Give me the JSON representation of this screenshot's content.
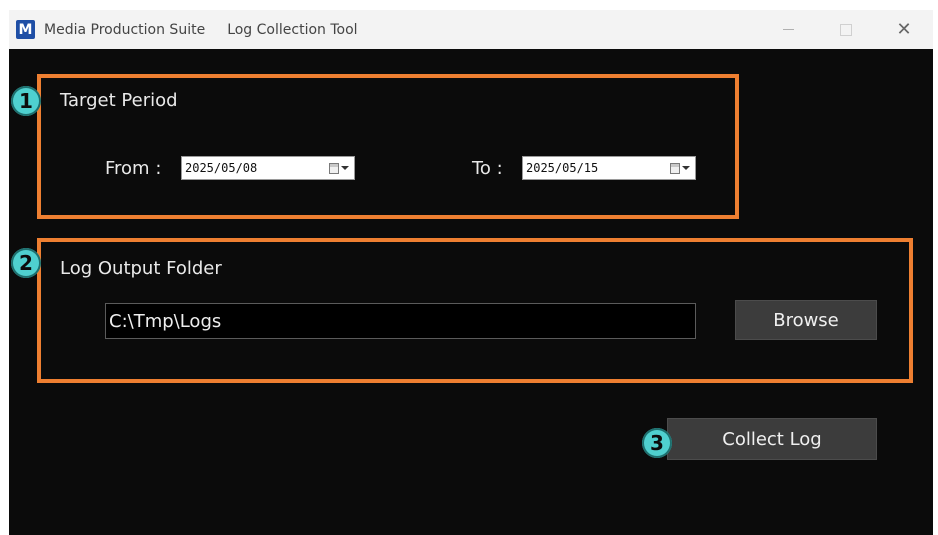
{
  "window": {
    "app_icon_letter": "M",
    "app_name": "Media Production Suite",
    "title": "Log Collection Tool"
  },
  "annotations": {
    "step1": "1",
    "step2": "2",
    "step3": "3",
    "highlight_color": "#ee7f31",
    "badge_color": "#4fd0cf"
  },
  "target_period": {
    "heading": "Target Period",
    "from_label": "From :",
    "from_value": "2025/05/08",
    "to_label": "To :",
    "to_value": "2025/05/15"
  },
  "output_folder": {
    "heading": "Log Output Folder",
    "path": "C:\\Tmp\\Logs",
    "browse_label": "Browse"
  },
  "actions": {
    "collect_label": "Collect Log"
  },
  "icons": {
    "app": "app-logo-icon",
    "minimize": "minimize-icon",
    "maximize": "maximize-icon",
    "close": "close-icon",
    "calendar": "calendar-icon",
    "dropdown": "chevron-down-icon"
  }
}
